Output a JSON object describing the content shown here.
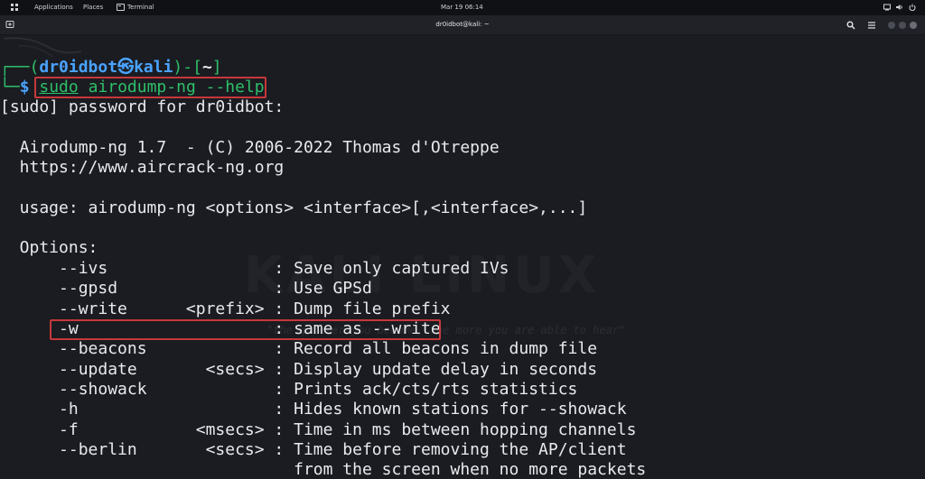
{
  "system_panel": {
    "applications": "Applications",
    "places": "Places",
    "terminal": "Terminal",
    "clock": "Mar 19  06:14"
  },
  "window": {
    "title": "dr0idbot@kali: ~"
  },
  "terminal": {
    "prompt_top_prefix": "┌──(",
    "prompt_user": "dr0idbot",
    "prompt_at": "㉿",
    "prompt_host": "kali",
    "prompt_dir_open": ")-[",
    "prompt_dir": "~",
    "prompt_dir_close": "]",
    "prompt_bottom_prefix": "└─",
    "prompt_dollar": "$",
    "command_sudo": "sudo",
    "command_rest": " airodump-ng --help",
    "lines": [
      "[sudo] password for dr0idbot:",
      "",
      "  Airodump-ng 1.7  - (C) 2006-2022 Thomas d'Otreppe",
      "  https://www.aircrack-ng.org",
      "",
      "  usage: airodump-ng <options> <interface>[,<interface>,...]",
      "",
      "  Options:",
      "      --ivs                 : Save only captured IVs",
      "      --gpsd                : Use GPSd",
      "      --write      <prefix> : Dump file prefix",
      "      -w                    : same as --write",
      "      --beacons             : Record all beacons in dump file",
      "      --update       <secs> : Display update delay in seconds",
      "      --showack             : Prints ack/cts/rts statistics",
      "      -h                    : Hides known stations for --showack",
      "      -f            <msecs> : Time in ms between hopping channels",
      "      --berlin       <secs> : Time before removing the AP/client",
      "                              from the screen when no more packets"
    ],
    "watermark_text": "KALI LINUX",
    "watermark_quote": "\"the quieter you become, the more you are able to hear\""
  },
  "colors": {
    "background": "#1a1c21",
    "highlight": "#c7383b",
    "prompt": "#4aa3ff",
    "command": "#2fbf6a"
  }
}
